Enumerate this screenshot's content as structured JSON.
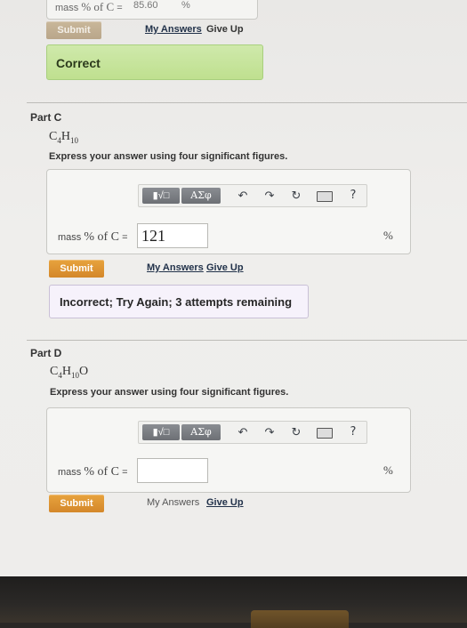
{
  "part_b_remnant": {
    "label_prefix": "mass",
    "label_symbol": "% of C",
    "label_eq": "=",
    "value": "85.60",
    "unit": "%",
    "submit_label": "Submit",
    "my_answers_label": "My Answers",
    "give_up_label": "Give Up",
    "feedback": "Correct"
  },
  "part_c": {
    "title": "Part C",
    "formula": {
      "c": "C",
      "c_sub": "4",
      "h": "H",
      "h_sub": "10",
      "o": ""
    },
    "instruction": "Express your answer using four significant figures.",
    "toolbar": {
      "templates": "▮√□",
      "greek": "ΑΣφ",
      "help": "?"
    },
    "answer_label": "mass",
    "answer_symbol": "% of C",
    "answer_eq": "=",
    "answer_value": "121",
    "unit": "%",
    "submit_label": "Submit",
    "my_answers_label": "My Answers",
    "give_up_label": "Give Up",
    "feedback": "Incorrect; Try Again; 3 attempts remaining"
  },
  "part_d": {
    "title": "Part D",
    "formula": {
      "c": "C",
      "c_sub": "4",
      "h": "H",
      "h_sub": "10",
      "o": "O"
    },
    "instruction": "Express your answer using four significant figures.",
    "toolbar": {
      "templates": "▮√□",
      "greek": "ΑΣφ",
      "help": "?"
    },
    "answer_label": "mass",
    "answer_symbol": "% of C",
    "answer_eq": "=",
    "answer_value": "",
    "unit": "%",
    "submit_label": "Submit",
    "my_answers_label": "My Answers",
    "give_up_label": "Give Up"
  },
  "colors": {
    "submit": "#d4872a",
    "correct_bg": "#c4e398",
    "link": "#22324a"
  }
}
